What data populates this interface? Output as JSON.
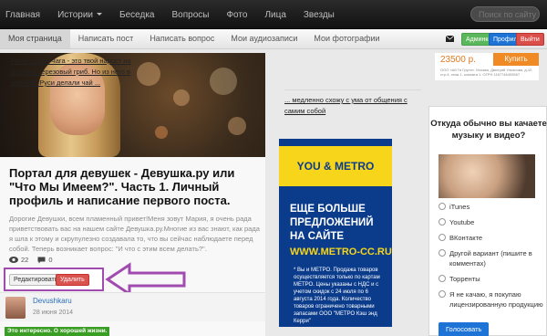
{
  "topnav": {
    "items": [
      "Главная",
      "Истории",
      "Беседка",
      "Вопросы",
      "Фото",
      "Лица",
      "Звезды"
    ],
    "search_placeholder": "Поиск по сайту"
  },
  "subnav": {
    "tabs": [
      "Моя страница",
      "Написать пост",
      "Написать вопрос",
      "Мои аудиозаписи",
      "Мои фотографии"
    ],
    "admin_label": "Админка",
    "profile_label": "Профиль",
    "exit_label": "Выйти"
  },
  "post": {
    "title": "Портал для девушек - Девушка.ру или \"Что Мы Имеем?\". Часть 1. Личный профиль и написание первого поста.",
    "excerpt": "Дорогие Девушки, всем пламенный привет!Меня зовут Мария, я очень рада приветствовать вас на нашем сайте Девушка.ру.Многие из вас знают, как рада я шла к этому и скрупулезно создавала то, что вы сейчас наблюдаете перед собой. Теперь возникает вопрос: \"И что с этим всем делать?\".",
    "views": "22",
    "comments": "0",
    "edit_label": "Редактировать",
    "delete_label": "Удалить",
    "author_name": "Devushkaru",
    "author_date": "28 июня 2014",
    "label": "Это интересно. О хорошей жизни."
  },
  "middle": {
    "link1": "Изначально Чага - это твой нарост на дереве, березовый гриб. Но из него в древней Руси делали чай ...",
    "link2": "... медленно схожу с ума от общения с самим собой"
  },
  "ad": {
    "logo": "YOU & METRO",
    "headline": "ЕЩЕ БОЛЬШЕ ПРЕДЛОЖЕНИЙ НА САЙТЕ",
    "site": "WWW.METRO-CC.RU",
    "note": "* Вы и МЕТРО. Продажа товаров осуществляется только по картам МЕТРО. Цены указаны с НДС и с учетом скидок с 24 июля по 6 августа 2014 года. Количество товаров ограничено товарными запасами ООО \"МЕТРО Кэш энд Керри\""
  },
  "right_ad": {
    "price": "23500 р.",
    "button": "Купить",
    "small": "ООО «Ай Ти Групп». Москва, Дмитрий Ульянова, д.42, стр.4, этаж 1, комната 1. ОГРН 1167746493567"
  },
  "poll": {
    "question": "Откуда обычно вы качаете музыку и видео?",
    "options": [
      "iTunes",
      "Youtube",
      "ВКонтакте",
      "Другой вариант (пишите в комментах)",
      "Торренты",
      "Я не качаю, я покупаю лицензированную продукцию"
    ],
    "vote_label": "Голосовать"
  }
}
